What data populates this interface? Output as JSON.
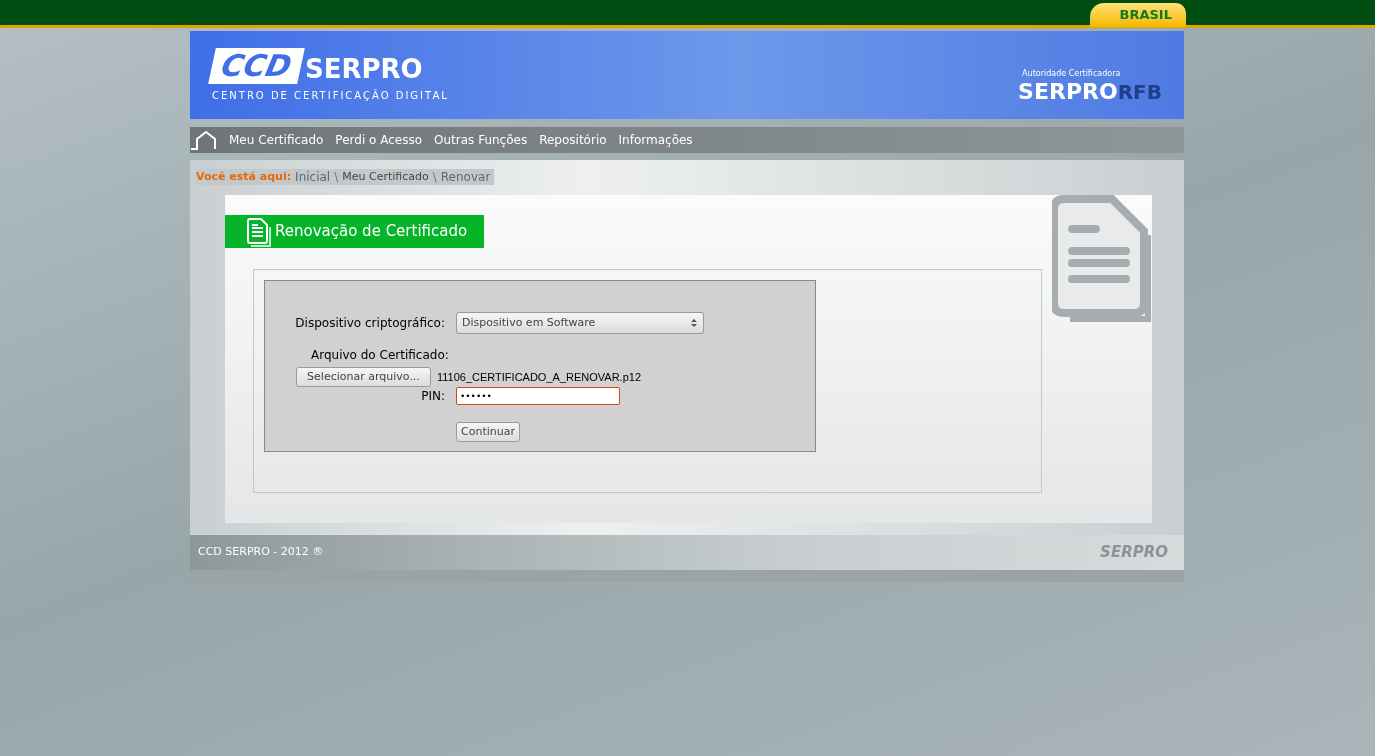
{
  "gov_bar": {
    "badge": "BRASIL"
  },
  "header": {
    "logo_mark": "CCD",
    "logo_word": "SERPRO",
    "logo_subtitle": "CENTRO DE CERTIFICAÇÃO DIGITAL",
    "authority_caption": "Autoridade Certificadora",
    "authority_word": "SERPRO",
    "authority_suffix": "RFB"
  },
  "nav": {
    "items": [
      "Meu Certificado",
      "Perdi o Acesso",
      "Outras Funções",
      "Repositório",
      "Informações"
    ]
  },
  "breadcrumb": {
    "label": "Você está aqui:",
    "items": [
      {
        "text": "Inicial",
        "separator": "\\"
      },
      {
        "text": "Meu Certificado",
        "separator": "\\"
      },
      {
        "text": "Renovar"
      }
    ]
  },
  "page_title": "Renovação de Certificado",
  "form": {
    "device_label": "Dispositivo criptográfico:",
    "device_value": "Dispositivo em Software",
    "file_label": "Arquivo do Certificado:",
    "file_button": "Selecionar arquivo...",
    "file_name": "11106_CERTIFICADO_A_RENOVAR.p12",
    "pin_label": "PIN:",
    "pin_value": "••••••",
    "pin_focused": true,
    "submit": "Continuar"
  },
  "footer": {
    "copyright": "CCD SERPRO - 2012 ®",
    "logo_word": "SERPRO"
  }
}
